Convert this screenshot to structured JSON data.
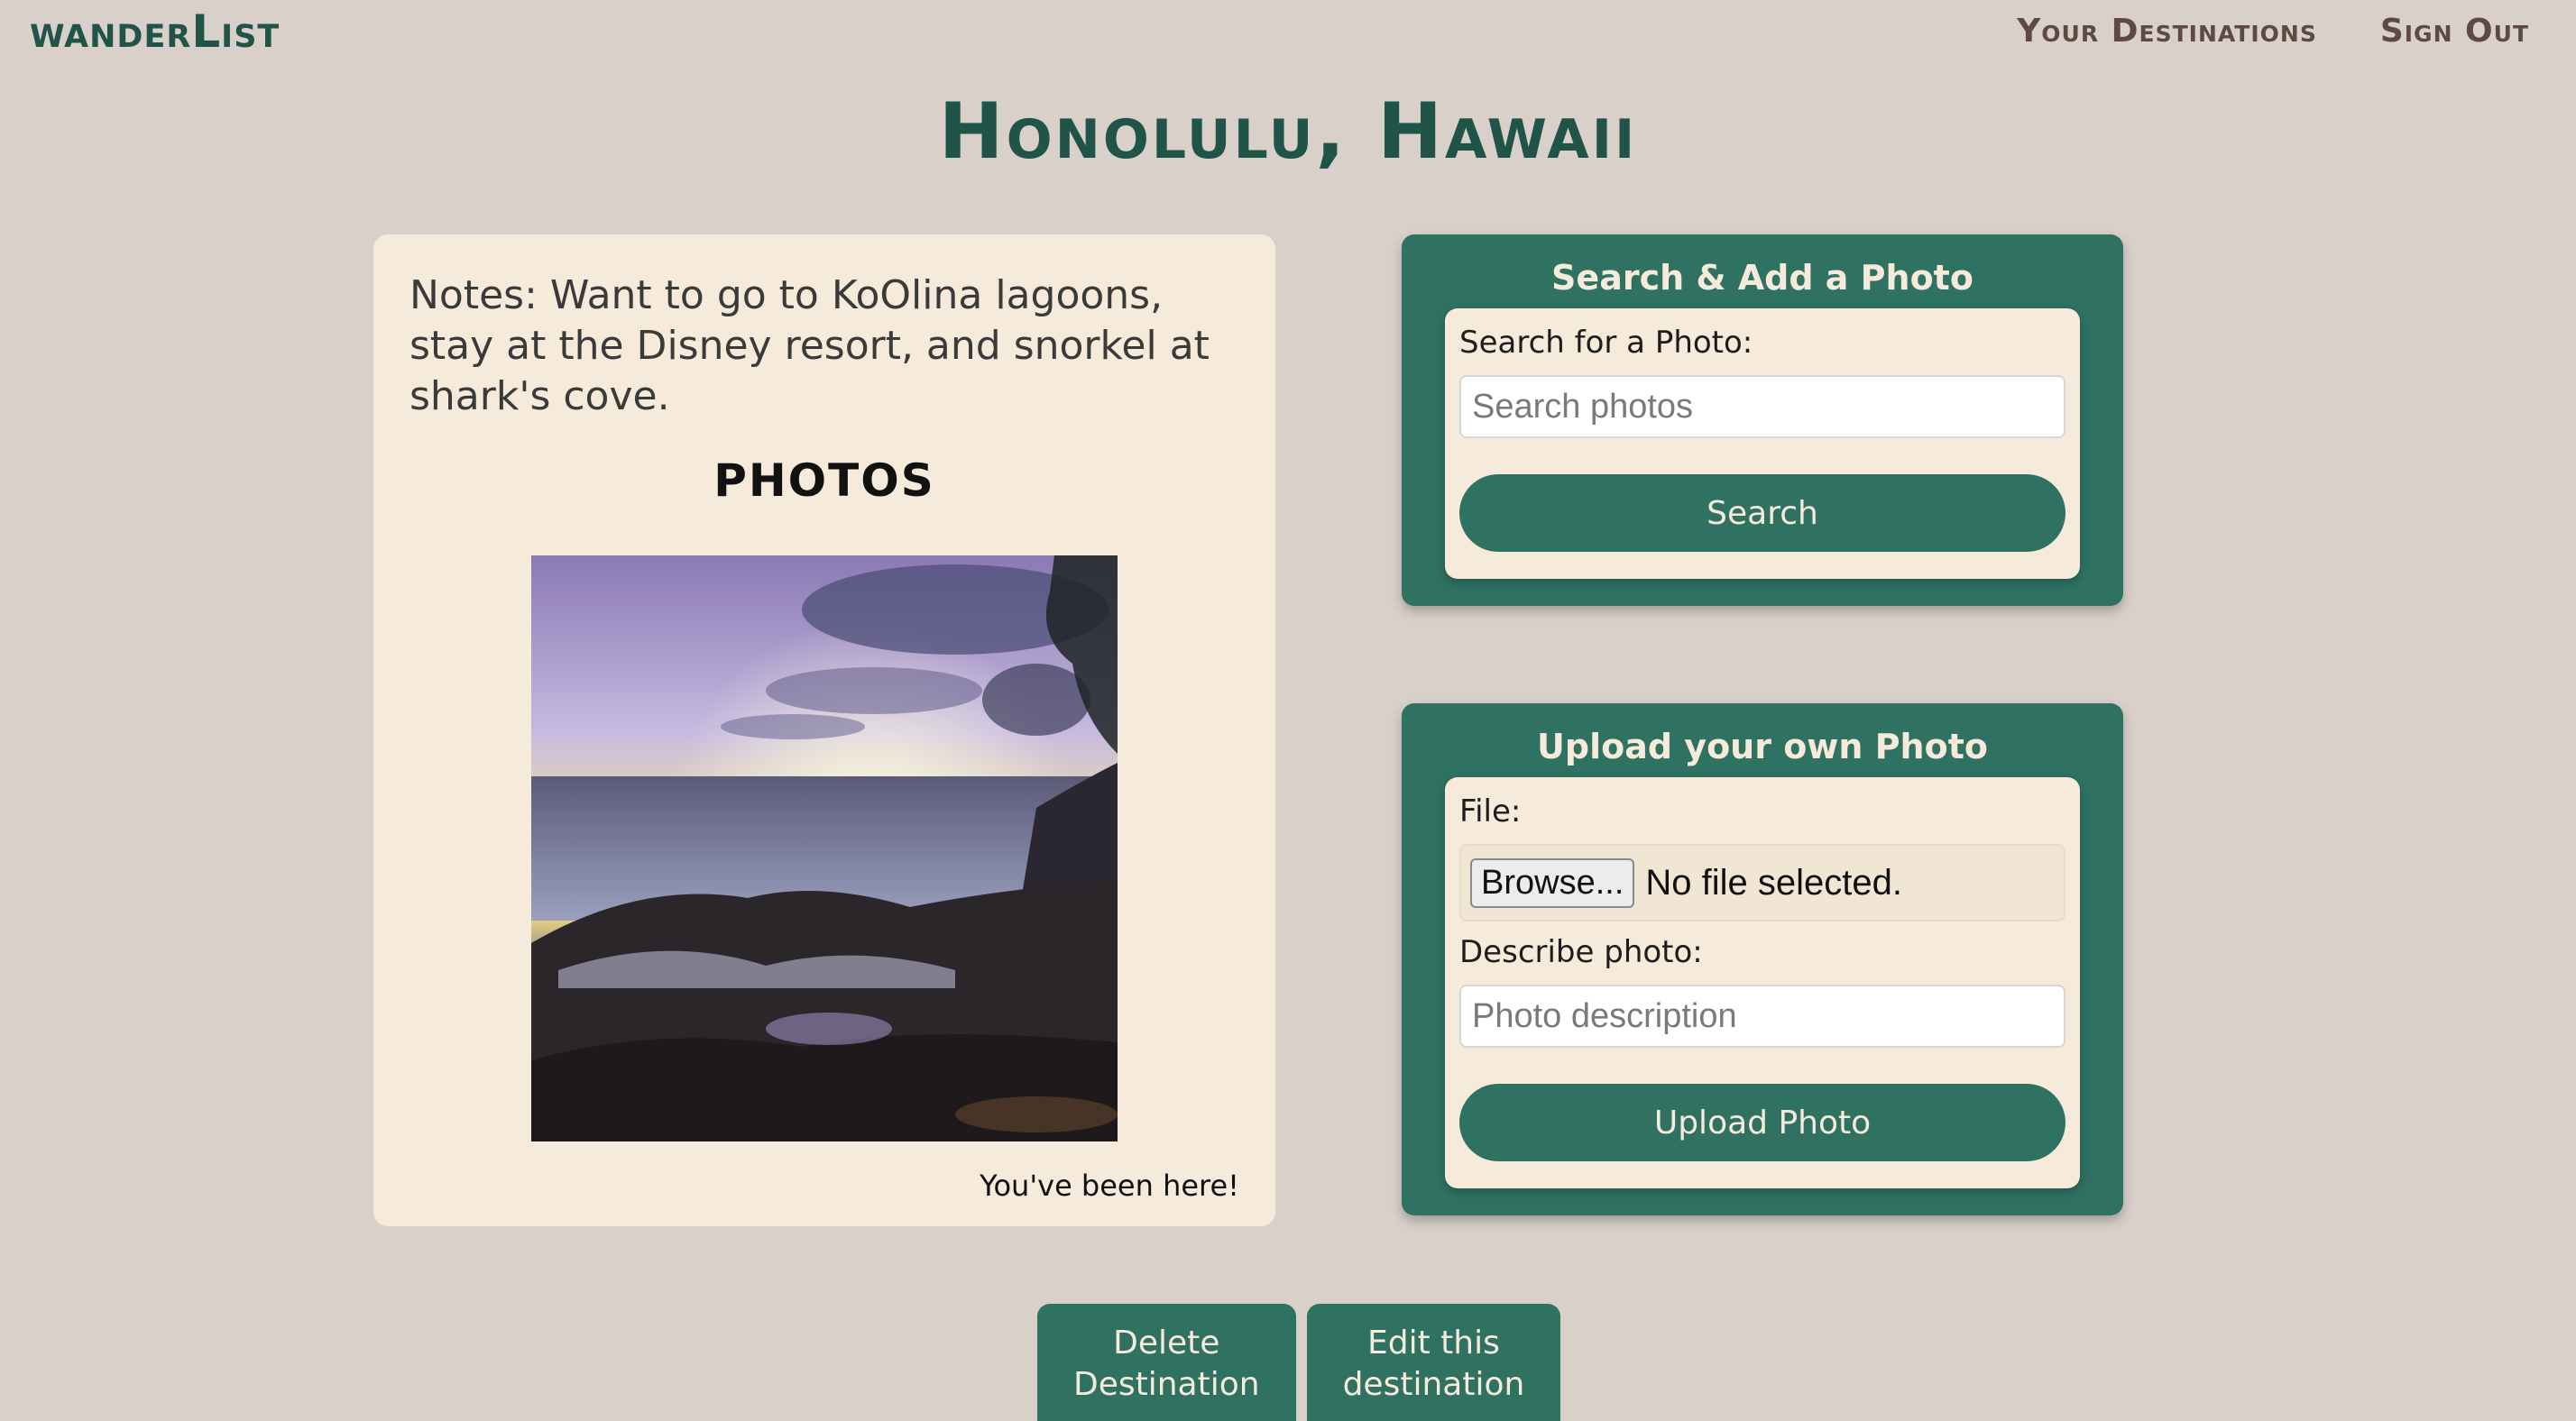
{
  "brand": "wanderList",
  "nav": {
    "destinations": "Your Destinations",
    "signout": "Sign Out"
  },
  "page_title": "Honolulu, Hawaii",
  "destination": {
    "notes": "Notes: Want to go to KoOlina lagoons, stay at the Disney resort, and snorkel at shark's cove.",
    "photos_heading": "PHOTOS",
    "visited_text": "You've been here!"
  },
  "search_panel": {
    "title": "Search & Add a Photo",
    "label": "Search for a Photo:",
    "placeholder": "Search photos",
    "button": "Search"
  },
  "upload_panel": {
    "title": "Upload your own Photo",
    "file_label": "File:",
    "browse_button": "Browse...",
    "file_status": "No file selected.",
    "describe_label": "Describe photo:",
    "describe_placeholder": "Photo description",
    "button": "Upload Photo"
  },
  "actions": {
    "delete": "Delete\nDestination",
    "edit": "Edit this\ndestination"
  },
  "colors": {
    "background": "#d9d0ca",
    "primary_green": "#2f7262",
    "dark_green": "#215449",
    "card": "#f6eadb",
    "nav_brown": "#5e4a40"
  }
}
